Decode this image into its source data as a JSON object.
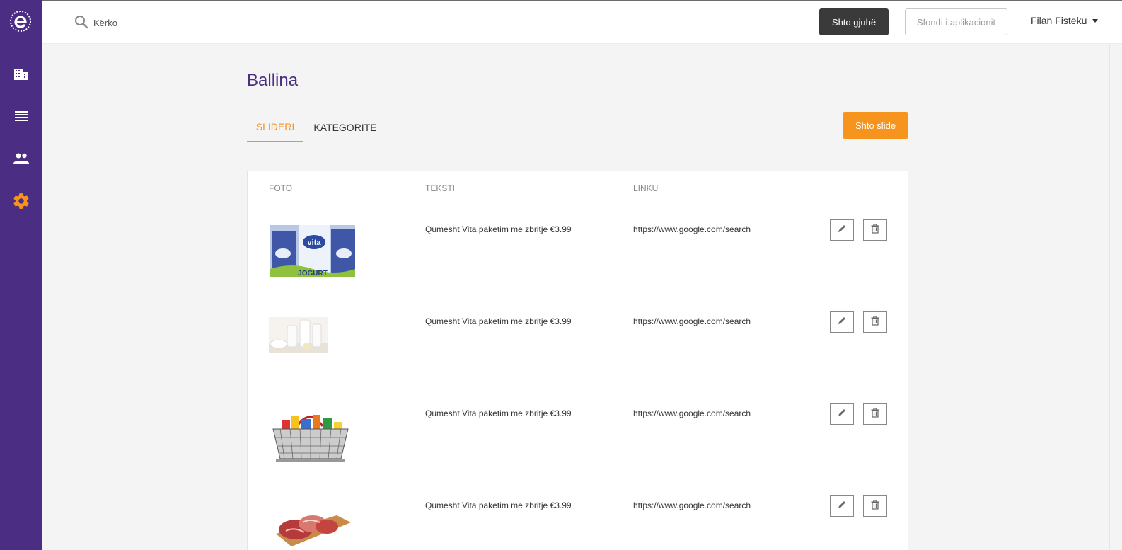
{
  "topbar": {
    "search_placeholder": "Kërko",
    "add_language_label": "Shto gjuhë",
    "app_background_label": "Sfondi i aplikacionit",
    "user_name": "Filan Fisteku"
  },
  "sidebar": {
    "items": [
      {
        "icon": "building-icon",
        "active": false
      },
      {
        "icon": "list-icon",
        "active": false
      },
      {
        "icon": "people-icon",
        "active": false
      },
      {
        "icon": "gear-icon",
        "active": true
      }
    ]
  },
  "page": {
    "title": "Ballina",
    "tabs": [
      {
        "label": "SLIDERI",
        "active": true
      },
      {
        "label": "KATEGORITE",
        "active": false
      }
    ],
    "add_slide_label": "Shto slide"
  },
  "table": {
    "headers": {
      "photo": "FOTO",
      "text": "TEKSTI",
      "link": "LINKU"
    },
    "rows": [
      {
        "image": "vita-milk-cartons",
        "text": "Qumesht Vita paketim me zbritje €3.99",
        "link": "https://www.google.com/search"
      },
      {
        "image": "dairy-products",
        "text": "Qumesht Vita paketim me zbritje €3.99",
        "link": "https://www.google.com/search"
      },
      {
        "image": "grocery-basket",
        "text": "Qumesht Vita paketim me zbritje €3.99",
        "link": "https://www.google.com/search"
      },
      {
        "image": "raw-meat",
        "text": "Qumesht Vita paketim me zbritje €3.99",
        "link": "https://www.google.com/search"
      }
    ]
  },
  "colors": {
    "sidebar": "#4b2d83",
    "accent": "#f7941d",
    "title": "#4b2d83",
    "dark_button": "#3a3a3a"
  }
}
